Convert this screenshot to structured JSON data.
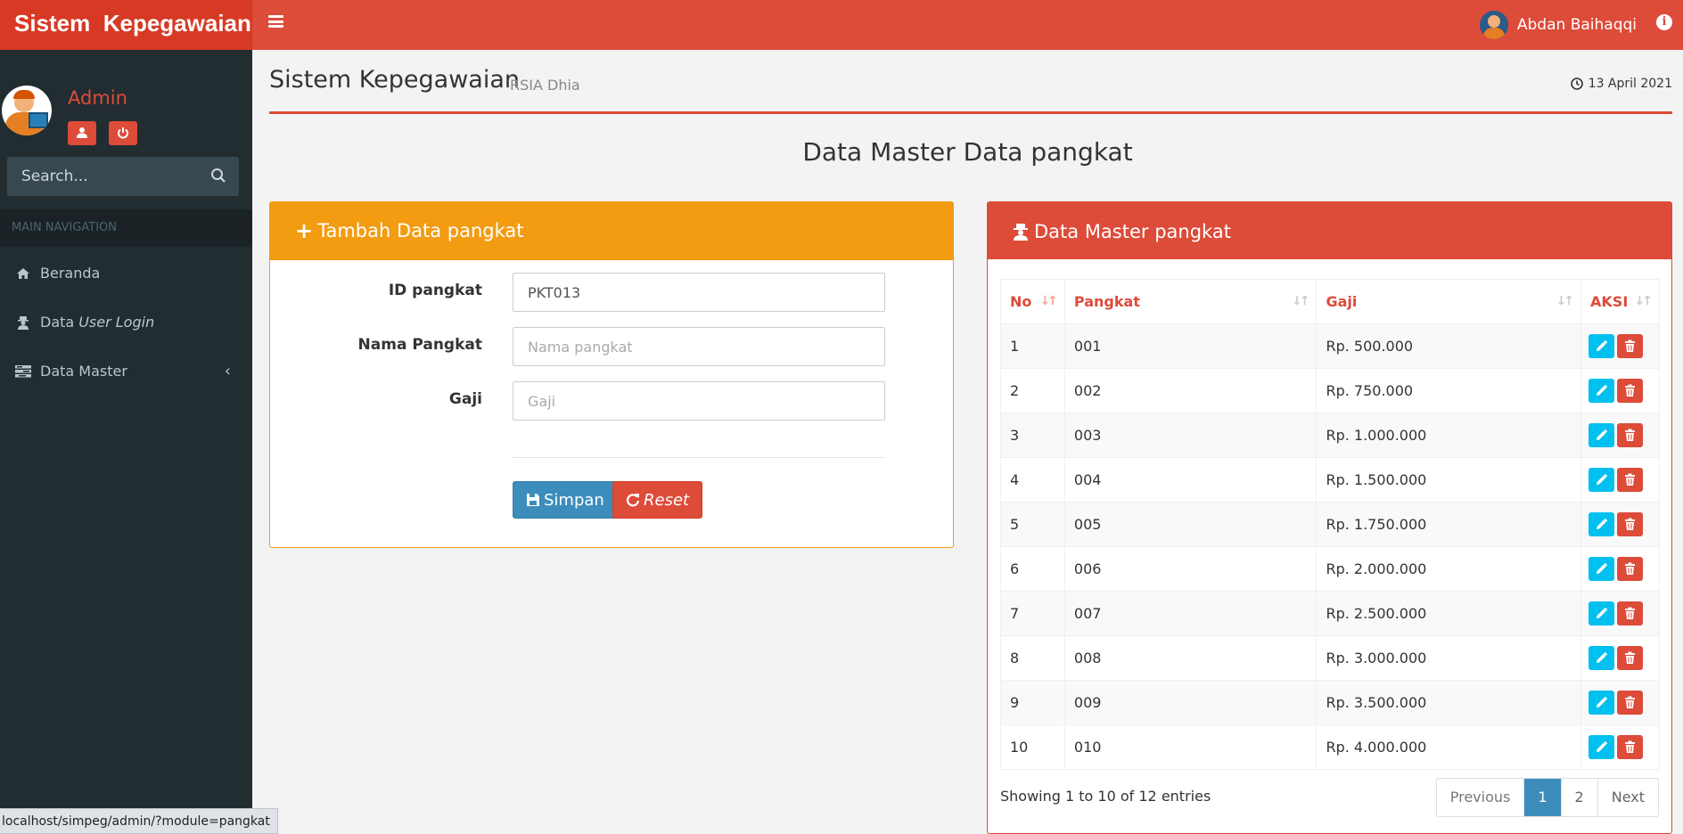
{
  "header": {
    "brand": "Sistem  Kepegawaian",
    "user_name": "Abdan Baihaqqi"
  },
  "sidebar": {
    "admin_name": "Admin",
    "search_placeholder": "Search...",
    "nav_header": "MAIN NAVIGATION",
    "items": [
      {
        "label": "Beranda",
        "icon": "home-icon"
      },
      {
        "label": "Data",
        "label_italic": "User Login",
        "icon": "user-secret-icon"
      },
      {
        "label": "Data Master",
        "icon": "tasks-icon"
      }
    ],
    "status_url": "localhost/simpeg/admin/?module=pangkat"
  },
  "content": {
    "title": "Sistem Kepegawaian",
    "subtitle": "RSIA Dhia",
    "date": "13 April 2021",
    "section_title": "Data Master Data pangkat"
  },
  "form": {
    "title": "Tambah Data pangkat",
    "fields": [
      {
        "label": "ID pangkat",
        "value": "PKT013",
        "placeholder": ""
      },
      {
        "label": "Nama Pangkat",
        "value": "",
        "placeholder": "Nama pangkat"
      },
      {
        "label": "Gaji",
        "value": "",
        "placeholder": "Gaji"
      }
    ],
    "save_label": "Simpan",
    "reset_label": "Reset"
  },
  "table": {
    "title": "Data Master pangkat",
    "columns": [
      "No",
      "Pangkat",
      "Gaji",
      "AKSI"
    ],
    "rows": [
      {
        "no": "1",
        "pangkat": "001",
        "gaji": "Rp. 500.000"
      },
      {
        "no": "2",
        "pangkat": "002",
        "gaji": "Rp. 750.000"
      },
      {
        "no": "3",
        "pangkat": "003",
        "gaji": "Rp. 1.000.000"
      },
      {
        "no": "4",
        "pangkat": "004",
        "gaji": "Rp. 1.500.000"
      },
      {
        "no": "5",
        "pangkat": "005",
        "gaji": "Rp. 1.750.000"
      },
      {
        "no": "6",
        "pangkat": "006",
        "gaji": "Rp. 2.000.000"
      },
      {
        "no": "7",
        "pangkat": "007",
        "gaji": "Rp. 2.500.000"
      },
      {
        "no": "8",
        "pangkat": "008",
        "gaji": "Rp. 3.000.000"
      },
      {
        "no": "9",
        "pangkat": "009",
        "gaji": "Rp. 3.500.000"
      },
      {
        "no": "10",
        "pangkat": "010",
        "gaji": "Rp. 4.000.000"
      }
    ],
    "info": "Showing 1 to 10 of 12 entries",
    "pagination": {
      "previous": "Previous",
      "pages": [
        "1",
        "2"
      ],
      "active_page": "1",
      "next": "Next"
    }
  },
  "colors": {
    "primary": "#dd4b39",
    "warning": "#f39c12",
    "info": "#00c0ef",
    "blue": "#3c8dbc",
    "sidebar": "#222d32"
  }
}
